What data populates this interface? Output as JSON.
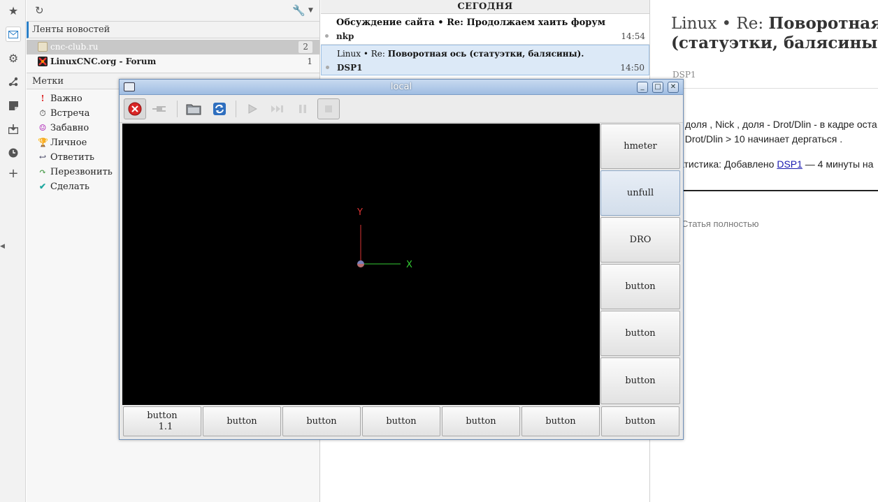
{
  "feeds_pane": {
    "feeds_header": "Ленты новостей",
    "feeds": [
      {
        "name": "cnc-club.ru",
        "count": "2"
      },
      {
        "name": "LinuxCNC.org - Forum",
        "count": "1"
      }
    ],
    "labels_header": "Метки",
    "labels": [
      {
        "name": "Важно",
        "icon": "exclamation-icon",
        "color": "#d22"
      },
      {
        "name": "Встреча",
        "icon": "clock-icon",
        "color": "#333"
      },
      {
        "name": "Забавно",
        "icon": "smiley-icon",
        "color": "#b02cb8"
      },
      {
        "name": "Личное",
        "icon": "trophy-icon",
        "color": "#e0a800"
      },
      {
        "name": "Ответить",
        "icon": "reply-icon",
        "color": "#335"
      },
      {
        "name": "Перезвонить",
        "icon": "phone-icon",
        "color": "#2a8a2a"
      },
      {
        "name": "Сделать",
        "icon": "check-icon",
        "color": "#1fa8a0"
      }
    ]
  },
  "headlines": {
    "date_header": "СЕГОДНЯ",
    "items": [
      {
        "title_prefix": "Обсуждение сайта • Re:",
        "title_main": "Продолжаем хаить форум",
        "author": "nkp",
        "time": "14:54"
      },
      {
        "title_prefix": "Linux • Re:",
        "title_main": "Поворотная ось (статуэтки, балясины).",
        "author": "DSP1",
        "time": "14:50"
      }
    ]
  },
  "article": {
    "title_line1_prefix": "Linux • Re:",
    "title_line1_main": "Поворотная",
    "title_line2": "(статуэтки, балясины",
    "author": "DSP1",
    "line1": "доля , Nick , доля - Drot/Dlin - в кадре оста",
    "line2": "и Drot/Dlin > 10 начинает дергаться .",
    "stats_prefix": "атистика: Добавлено ",
    "stats_link": "DSP1",
    "stats_suffix": " — 4 минуты на",
    "full_link": "Статья полностью"
  },
  "window": {
    "title": "local",
    "axis_x": "X",
    "axis_y": "Y",
    "side_buttons": [
      "hmeter",
      "unfull",
      "DRO",
      "button",
      "button",
      "button"
    ],
    "bottom_buttons": [
      {
        "line1": "button",
        "line2": "1.1"
      },
      {
        "line1": "button"
      },
      {
        "line1": "button"
      },
      {
        "line1": "button"
      },
      {
        "line1": "button"
      },
      {
        "line1": "button"
      },
      {
        "line1": "button"
      }
    ]
  }
}
